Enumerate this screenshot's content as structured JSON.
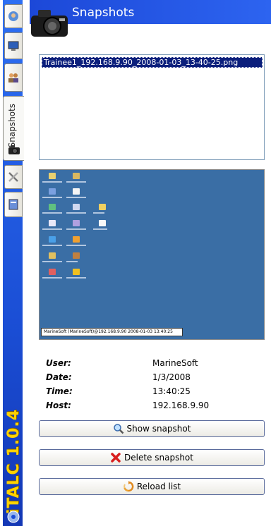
{
  "header": {
    "title": "Snapshots"
  },
  "sidebar": {
    "tabs": [
      {
        "name": "overview-mode",
        "icon": "classroom-icon"
      },
      {
        "name": "remote-control",
        "icon": "monitor-icon"
      },
      {
        "name": "users",
        "icon": "users-icon"
      },
      {
        "name": "snapshots",
        "label": "Snapshots",
        "icon": "camera-icon"
      },
      {
        "name": "config",
        "icon": "tools-icon"
      },
      {
        "name": "about",
        "icon": "help-icon"
      }
    ],
    "logo_text": "iTALC 1.0.4"
  },
  "file_list": {
    "items": [
      "Trainee1_192.168.9.90_2008-01-03_13-40-25.png"
    ]
  },
  "preview": {
    "taskbar_text": "MarineSoft (MarineSoft)@192.168.9.90 2008-01-03 13:40:25"
  },
  "info": {
    "user_label": "User:",
    "user_value": "MarineSoft",
    "date_label": "Date:",
    "date_value": "1/3/2008",
    "time_label": "Time:",
    "time_value": "13:40:25",
    "host_label": "Host:",
    "host_value": "192.168.9.90"
  },
  "buttons": {
    "show_label": "Show snapshot",
    "delete_label": "Delete snapshot",
    "reload_label": "Reload list"
  },
  "colors": {
    "header_blue": "#1c48d8",
    "selection": "#0b1f7c",
    "logo_yellow": "#ffd200"
  }
}
